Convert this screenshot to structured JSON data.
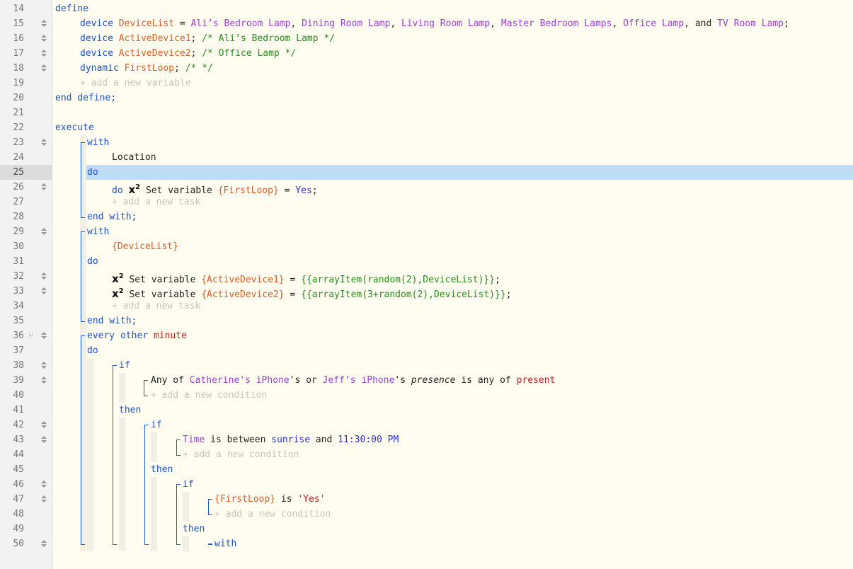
{
  "editor": {
    "line_numbers": [
      "14",
      "15",
      "16",
      "17",
      "18",
      "19",
      "20",
      "21",
      "22",
      "23",
      "24",
      "25",
      "26",
      "27",
      "28",
      "29",
      "30",
      "31",
      "32",
      "33",
      "34",
      "35",
      "36",
      "37",
      "38",
      "39",
      "40",
      "41",
      "42",
      "43",
      "44",
      "45",
      "46",
      "47",
      "48",
      "49",
      "50"
    ],
    "active_line": "25",
    "tokens": {
      "define": "define",
      "device": "device",
      "devicelist": "DeviceList",
      "eq": " = ",
      "lamp1": "Ali’s Bedroom Lamp",
      "lamp2": "Dining Room Lamp",
      "lamp3": "Living Room Lamp",
      "lamp4": "Master Bedroom Lamps",
      "lamp5": "Office Lamp",
      "and": "and",
      "lamp6": "TV Room Lamp",
      "comma": ", ",
      "semi": ";",
      "active1": "ActiveDevice1",
      "active2": "ActiveDevice2",
      "cm1": "/* Ali’s Bedroom Lamp */",
      "cm2": "/* Office Lamp */",
      "dynamic": "dynamic",
      "firstloop": "FirstLoop",
      "cm3": "/* */",
      "add_variable": "+ add a new variable",
      "end_define": "end define;",
      "execute": "execute",
      "with": "with",
      "location": "Location",
      "do": "do",
      "x2": "x",
      "sq": "2",
      "set_variable": "Set variable",
      "firstloop_ref": "{FirstLoop}",
      "yes": "Yes",
      "add_task": "+ add a new task",
      "end_with": "end with;",
      "devicelist_ref": "{DeviceList}",
      "active1_ref": "{ActiveDevice1}",
      "active2_ref": "{ActiveDevice2}",
      "expr1": "{{arrayItem(random(2),DeviceList)}}",
      "expr2": "{{arrayItem(3+random(2),DeviceList)}}",
      "every": "every",
      "other": "other",
      "minute": "minute",
      "if": "if",
      "any_of": "Any of",
      "catherine": "Catherine's iPhone",
      "s_or": "'s or",
      "jeff": "Jeff’s iPhone",
      "s": "'s",
      "presence": "presence",
      "is_any_of": "is any of",
      "present": "present",
      "add_condition": "+ add a new condition",
      "then": "then",
      "time": "Time",
      "is_between": "is between",
      "sunrise": "sunrise",
      "time_val": "11:30:00 PM",
      "is": "is",
      "yes_str": "'Yes'"
    }
  }
}
